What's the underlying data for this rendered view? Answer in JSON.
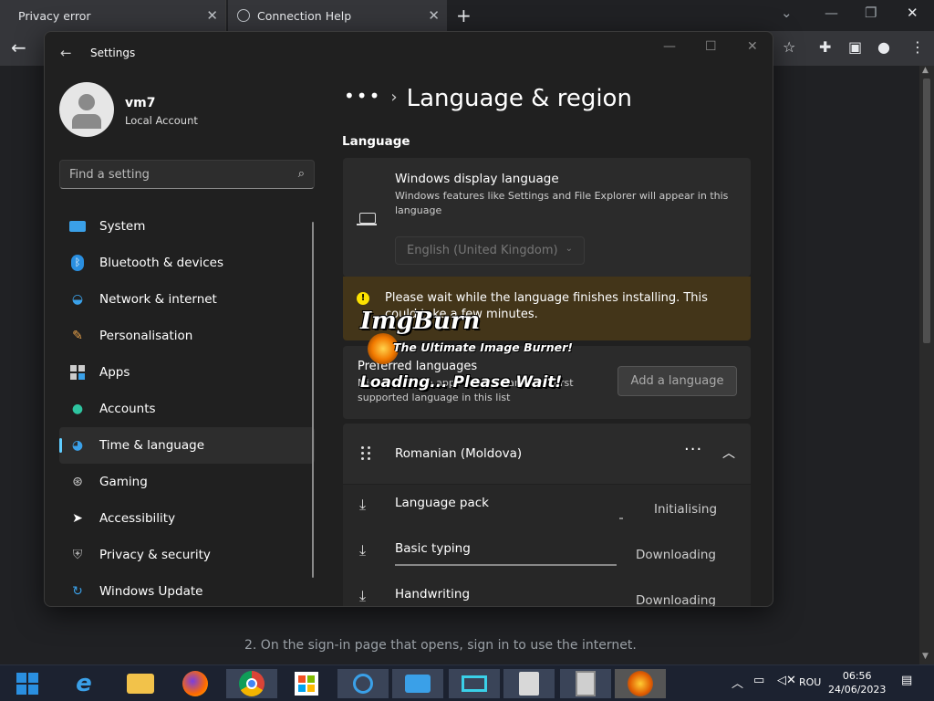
{
  "browser": {
    "tabs": [
      {
        "label": "Privacy error"
      },
      {
        "label": "Connection Help"
      }
    ],
    "page_text": "2. On the sign-in page that opens, sign in to use the internet."
  },
  "settings": {
    "window_title": "Settings",
    "user": {
      "name": "vm7",
      "account_type": "Local Account"
    },
    "search_placeholder": "Find a setting",
    "nav": [
      {
        "label": "System",
        "icon": "monitor-icon"
      },
      {
        "label": "Bluetooth & devices",
        "icon": "bluetooth-icon"
      },
      {
        "label": "Network & internet",
        "icon": "wifi-icon"
      },
      {
        "label": "Personalisation",
        "icon": "brush-icon"
      },
      {
        "label": "Apps",
        "icon": "apps-icon"
      },
      {
        "label": "Accounts",
        "icon": "person-icon"
      },
      {
        "label": "Time & language",
        "icon": "globe-clock-icon",
        "selected": true
      },
      {
        "label": "Gaming",
        "icon": "gamepad-icon"
      },
      {
        "label": "Accessibility",
        "icon": "accessibility-icon"
      },
      {
        "label": "Privacy & security",
        "icon": "shield-icon"
      },
      {
        "label": "Windows Update",
        "icon": "update-icon"
      }
    ],
    "breadcrumb": {
      "dots": "•••",
      "title": "Language & region"
    },
    "section": "Language",
    "display_language": {
      "title": "Windows display language",
      "desc": "Windows features like Settings and File Explorer will appear in this language",
      "value": "English (United Kingdom)"
    },
    "warning": "Please wait while the language finishes installing. This could take a few minutes.",
    "preferred": {
      "title": "Preferred languages",
      "desc": "Microsoft Store apps will appear in the first supported language in this list",
      "button": "Add a language"
    },
    "language": {
      "name": "Romanian (Moldova)",
      "features": [
        {
          "title": "Language pack",
          "status": "Initialising",
          "progress": 0.1
        },
        {
          "title": "Basic typing",
          "status": "Downloading",
          "progress": 1.0
        },
        {
          "title": "Handwriting",
          "status": "Downloading",
          "progress": 0
        }
      ]
    }
  },
  "imgburn": {
    "logo": "ImgBurn",
    "subtitle": "The Ultimate Image Burner!",
    "loading": "Loading... Please Wait!"
  },
  "taskbar": {
    "lang": "ROU",
    "time": "06:56",
    "date": "24/06/2023"
  }
}
